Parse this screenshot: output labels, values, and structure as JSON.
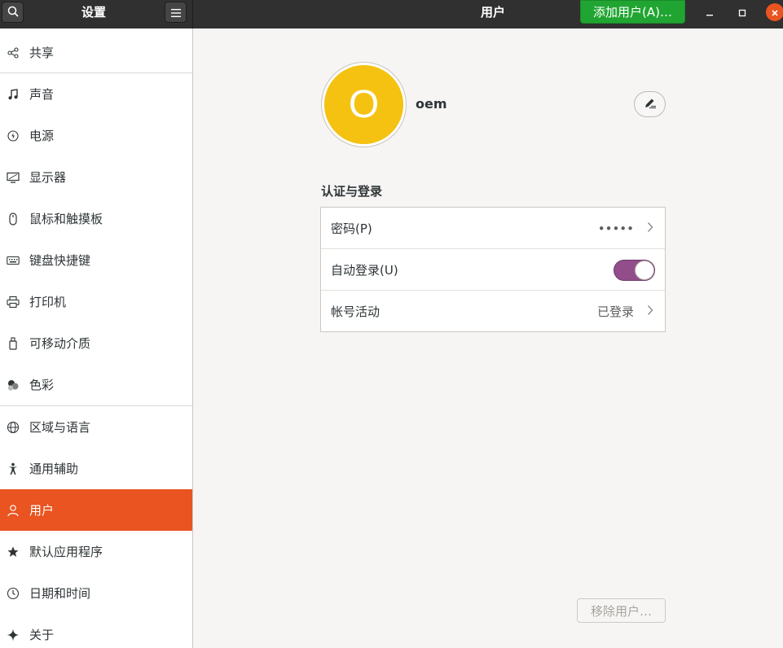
{
  "header": {
    "settings_title": "设置",
    "page_title": "用户",
    "add_user_label": "添加用户(A)…",
    "search_icon": "search-icon",
    "menu_icon": "hamburger-menu-icon"
  },
  "window_controls": {
    "minimize": "minimize-icon",
    "maximize": "maximize-icon",
    "close": "close-icon"
  },
  "sidebar": {
    "items": [
      {
        "label": "共享",
        "icon": "share-icon"
      },
      {
        "label": "声音",
        "icon": "music-note-icon"
      },
      {
        "label": "电源",
        "icon": "power-icon"
      },
      {
        "label": "显示器",
        "icon": "display-icon"
      },
      {
        "label": "鼠标和触摸板",
        "icon": "mouse-icon"
      },
      {
        "label": "键盘快捷键",
        "icon": "keyboard-icon"
      },
      {
        "label": "打印机",
        "icon": "printer-icon"
      },
      {
        "label": "可移动介质",
        "icon": "removable-media-icon"
      },
      {
        "label": "色彩",
        "icon": "color-icon"
      },
      {
        "label": "区域与语言",
        "icon": "globe-icon"
      },
      {
        "label": "通用辅助",
        "icon": "accessibility-icon"
      },
      {
        "label": "用户",
        "icon": "user-icon"
      },
      {
        "label": "默认应用程序",
        "icon": "star-icon"
      },
      {
        "label": "日期和时间",
        "icon": "clock-icon"
      },
      {
        "label": "关于",
        "icon": "sparkle-icon"
      }
    ],
    "active": "用户"
  },
  "user": {
    "avatar_letter": "O",
    "name": "oem",
    "avatar_color": "#f5c211"
  },
  "auth_section": {
    "title": "认证与登录",
    "password_label": "密码(P)",
    "password_value": "•••••",
    "autologin_label": "自动登录(U)",
    "autologin_on": true,
    "activity_label": "帐号活动",
    "activity_value": "已登录"
  },
  "remove_user_label": "移除用户…",
  "colors": {
    "accent": "#e95420",
    "toggle_on": "#924d8b",
    "add_button": "#21a532"
  }
}
